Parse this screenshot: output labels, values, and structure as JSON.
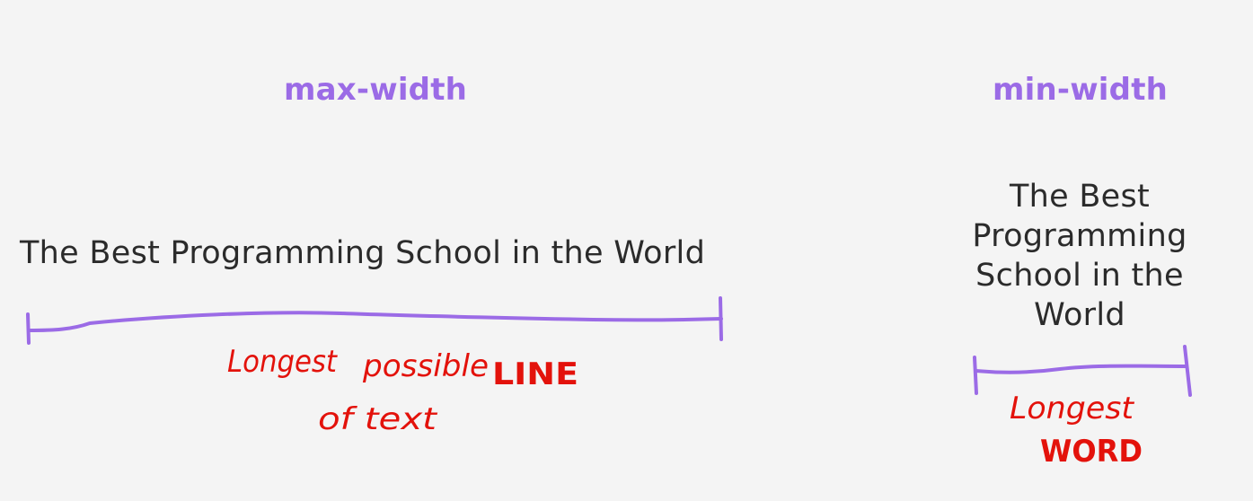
{
  "colors": {
    "background": "#f4f4f4",
    "heading": "#9b6be6",
    "bracket": "#9b6be6",
    "annotation": "#e3120b",
    "text": "#2b2b2b"
  },
  "max_width": {
    "heading": "max-width",
    "sample_text": "The Best Programming School in the World",
    "annotation_line1_a": "Longest",
    "annotation_line1_b": "possible",
    "annotation_line1_c": "LINE",
    "annotation_line2": "of text"
  },
  "min_width": {
    "heading": "min-width",
    "sample_text_lines": [
      "The Best",
      "Programming",
      "School in the",
      "World"
    ],
    "annotation_line1": "Longest",
    "annotation_line2": "WORD"
  }
}
